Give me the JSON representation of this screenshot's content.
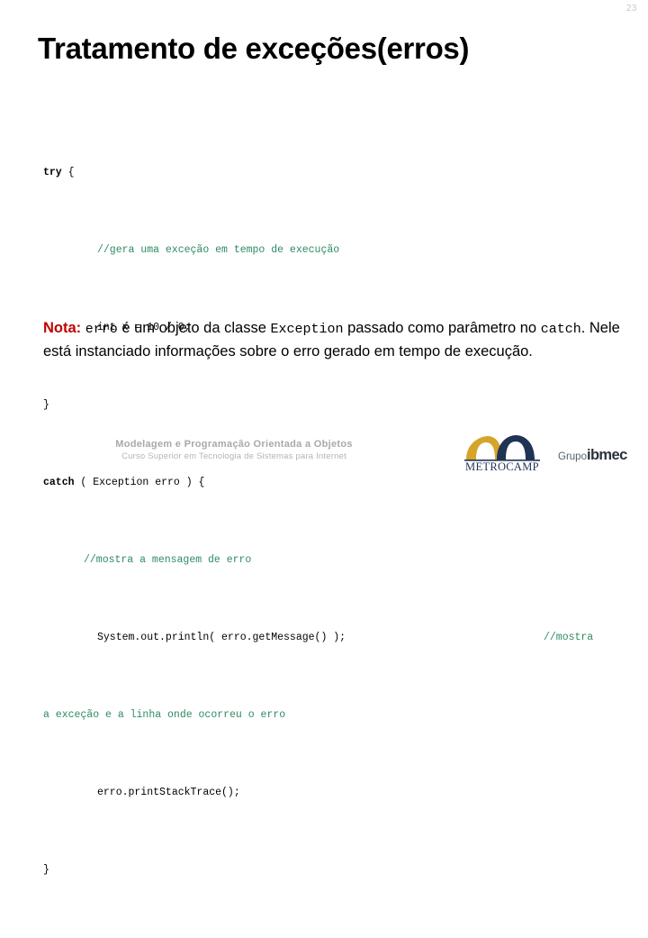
{
  "slide": {
    "number": "23",
    "title": "Tratamento de exceções(erros)"
  },
  "code": {
    "lines": [
      {
        "indent": 0,
        "keyword": "try ",
        "text": "{",
        "comment": ""
      },
      {
        "indent": 60,
        "keyword": "",
        "text": "",
        "comment": "//gera uma exceção em tempo de execução"
      },
      {
        "indent": 60,
        "keyword": "",
        "text": "int x = 10 / 0;",
        "comment": ""
      },
      {
        "indent": 0,
        "keyword": "",
        "text": "}",
        "comment": ""
      },
      {
        "indent": 0,
        "keyword": "catch",
        "text": " ( Exception erro ) {",
        "comment": ""
      },
      {
        "indent": 45,
        "keyword": "",
        "text": "",
        "comment": "//mostra a mensagem de erro"
      },
      {
        "indent": 60,
        "keyword": "",
        "text": "System.out.println( erro.getMessage() );",
        "comment": "",
        "trailing_comment": "//mostra"
      },
      {
        "indent": 0,
        "keyword": "",
        "text": "",
        "comment": "a exceção e a linha onde ocorreu o erro"
      },
      {
        "indent": 60,
        "keyword": "",
        "text": "erro.printStackTrace();",
        "comment": ""
      },
      {
        "indent": 0,
        "keyword": "",
        "text": "}",
        "comment": ""
      }
    ]
  },
  "note": {
    "label": "Nota:",
    "code_erro": "erro",
    "part1": " é um objeto da classe ",
    "code_exception": "Exception",
    "part2": " passado como parâmetro no ",
    "code_catch": "catch",
    "part3": ". Nele está instanciado informações sobre o erro gerado em tempo de execução."
  },
  "footer": {
    "course_title": "Modelagem e Programação Orientada a Objetos",
    "course_subtitle": "Curso Superior em Tecnologia de Sistemas para Internet",
    "metrocamp_label": "METROCAMP",
    "ibmec_prefix": "Grupo",
    "ibmec_name": "ibmec"
  },
  "colors": {
    "comment_green": "#2e8b62",
    "note_red": "#c00000",
    "metrocamp_gold": "#d5a429",
    "metrocamp_navy": "#1f3355",
    "footer_gray": "#a9a9a9"
  }
}
